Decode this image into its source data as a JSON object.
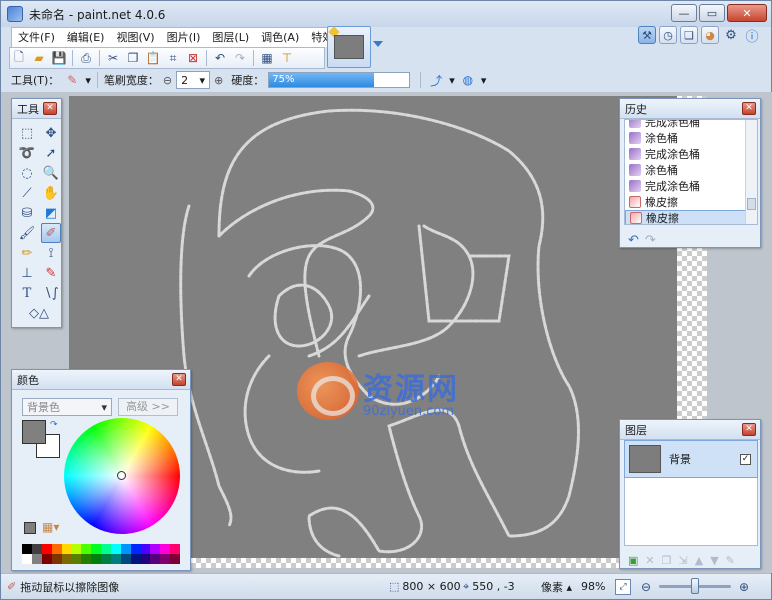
{
  "window": {
    "title": "未命名 - paint.net 4.0.6",
    "controls": [
      "minimize-icon",
      "maximize-icon",
      "close-icon"
    ]
  },
  "menu": {
    "items": [
      "文件(F)",
      "编辑(E)",
      "视图(V)",
      "图片(I)",
      "图层(L)",
      "调色(A)",
      "特效(C)"
    ]
  },
  "toolbar": {
    "icons": [
      "new-icon",
      "open-icon",
      "save-icon",
      "print-icon",
      "cut-icon",
      "copy-icon",
      "paste-icon",
      "crop-icon",
      "deselect-icon",
      "undo-icon",
      "redo-icon",
      "grid-icon",
      "ruler-icon"
    ]
  },
  "tool_options": {
    "tool_label": "工具(T)：",
    "brush_width_label": "笔刷宽度：",
    "brush_width_value": "2",
    "hardness_label": "硬度：",
    "hardness_value": "75%",
    "hardness_fraction": 0.75
  },
  "tools_panel": {
    "title": "工具",
    "tools": [
      "rectangle-select",
      "move-selection",
      "lasso-select",
      "move-selected",
      "ellipse-select",
      "zoom",
      "magic-wand",
      "pan",
      "paint-bucket",
      "gradient",
      "paintbrush",
      "eraser",
      "pencil",
      "color-picker",
      "clone-stamp",
      "recolor",
      "text",
      "line-curve",
      "shapes"
    ],
    "selected": "eraser"
  },
  "history_panel": {
    "title": "历史",
    "items": [
      {
        "label": "完成涂色桶",
        "icon": "bucket"
      },
      {
        "label": "涂色桶",
        "icon": "bucket"
      },
      {
        "label": "完成涂色桶",
        "icon": "bucket"
      },
      {
        "label": "涂色桶",
        "icon": "bucket"
      },
      {
        "label": "完成涂色桶",
        "icon": "bucket"
      },
      {
        "label": "橡皮擦",
        "icon": "eraser"
      },
      {
        "label": "橡皮擦",
        "icon": "eraser",
        "selected": true
      }
    ]
  },
  "colors_panel": {
    "title": "颜色",
    "mode_select": "背景色",
    "advanced_button": "高级 >>",
    "primary_color": "#808080",
    "secondary_color": "#ffffff",
    "palette": [
      "#000000",
      "#404040",
      "#ff0000",
      "#ff6a00",
      "#ffd800",
      "#b6ff00",
      "#4cff00",
      "#00ff21",
      "#00ff90",
      "#00ffff",
      "#0094ff",
      "#0026ff",
      "#4800ff",
      "#b200ff",
      "#ff00dc",
      "#ff006e",
      "#ffffff",
      "#808080",
      "#7f0000",
      "#7f3300",
      "#7f6a00",
      "#5b7f00",
      "#267f00",
      "#007f0e",
      "#007f46",
      "#007f7f",
      "#004a7f",
      "#00137f",
      "#21007f",
      "#57007f",
      "#7f006e",
      "#7f0037"
    ]
  },
  "layers_panel": {
    "title": "图层",
    "layers": [
      {
        "name": "背景",
        "visible": true
      }
    ]
  },
  "status": {
    "hint": "拖动鼠标以擦除图像",
    "image_size": "800 × 600",
    "cursor_pos": "550 , -3",
    "unit": "像素",
    "zoom": "98%"
  },
  "watermark": {
    "cn": "资源网",
    "en": "90ziyuen.com"
  }
}
